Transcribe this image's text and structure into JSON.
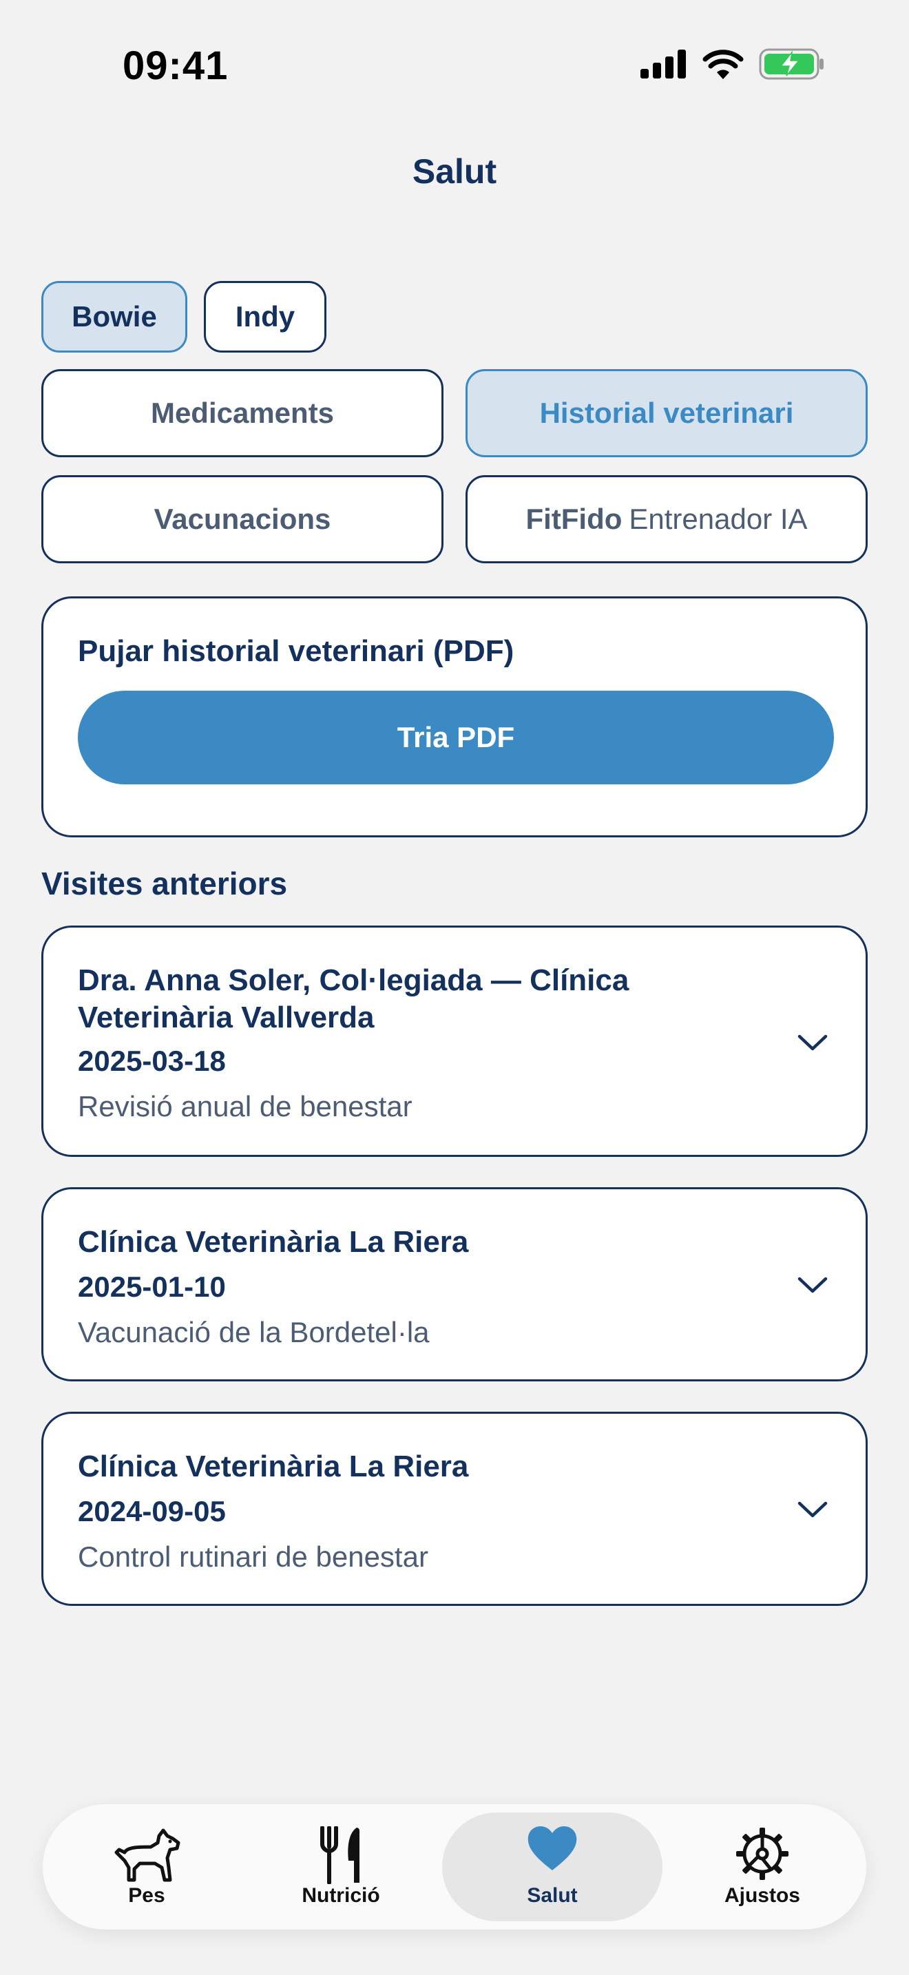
{
  "status": {
    "time": "09:41",
    "icons": [
      "cellular-signal-icon",
      "wifi-icon",
      "battery-charging-icon"
    ]
  },
  "header": {
    "title": "Salut"
  },
  "pets": [
    {
      "name": "Bowie",
      "selected": true
    },
    {
      "name": "Indy",
      "selected": false
    }
  ],
  "segments": {
    "medications": "Medicaments",
    "vet_history": "Historial veterinari",
    "vaccinations": "Vacunacions",
    "coach_brand": "FitFido",
    "coach_rest": "Entrenador IA",
    "selected": "vet_history"
  },
  "upload": {
    "title": "Pujar historial veterinari (PDF)",
    "button": "Tria PDF"
  },
  "visits": {
    "section_title": "Visites anteriors",
    "items": [
      {
        "clinic": "Dra. Anna Soler, Col·legiada — Clínica Veterinària Vallverda",
        "date": "2025-03-18",
        "description": "Revisió anual de benestar"
      },
      {
        "clinic": "Clínica Veterinària La Riera",
        "date": "2025-01-10",
        "description": "Vacunació de la Bordetel·la"
      },
      {
        "clinic": "Clínica Veterinària La Riera",
        "date": "2024-09-05",
        "description": "Control rutinari de benestar"
      }
    ]
  },
  "tabbar": {
    "items": [
      {
        "label": "Pes",
        "icon": "dog-icon"
      },
      {
        "label": "Nutrició",
        "icon": "fork-knife-icon"
      },
      {
        "label": "Salut",
        "icon": "heart-icon"
      },
      {
        "label": "Ajustos",
        "icon": "gear-icon"
      }
    ],
    "selected": "Salut"
  },
  "colors": {
    "navy": "#13315c",
    "accent": "#3b8ac4",
    "accent_light": "#d6e3ee",
    "muted": "#4c5d73",
    "background": "#f2f2f2",
    "battery": "#34c759"
  }
}
